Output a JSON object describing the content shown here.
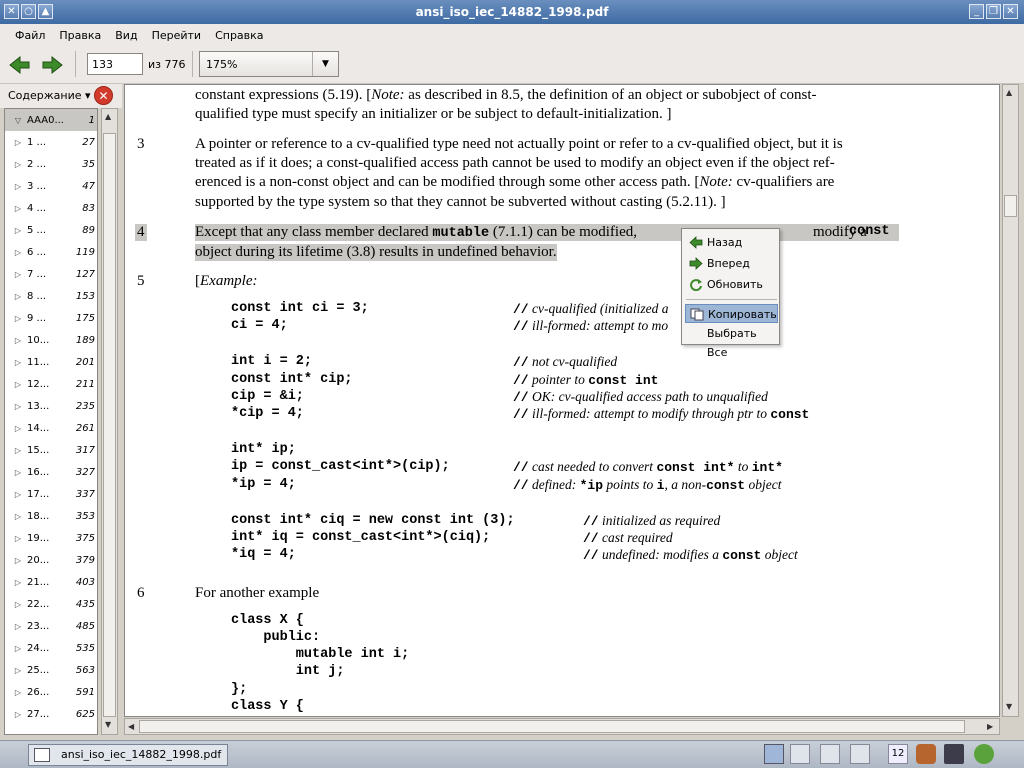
{
  "window": {
    "title": "ansi_iso_iec_14882_1998.pdf"
  },
  "menu": [
    "Файл",
    "Правка",
    "Вид",
    "Перейти",
    "Справка"
  ],
  "toolbar": {
    "page_value": "133",
    "page_of": "из 776",
    "zoom": "175%"
  },
  "sidebar": {
    "header": "Содержание",
    "items": [
      {
        "label": "AAA0...",
        "page": "1",
        "selected": true
      },
      {
        "label": "1 ...",
        "page": "27"
      },
      {
        "label": "2 ...",
        "page": "35"
      },
      {
        "label": "3 ...",
        "page": "47"
      },
      {
        "label": "4 ...",
        "page": "83"
      },
      {
        "label": "5 ...",
        "page": "89"
      },
      {
        "label": "6 ...",
        "page": "119"
      },
      {
        "label": "7 ...",
        "page": "127"
      },
      {
        "label": "8 ...",
        "page": "153"
      },
      {
        "label": "9 ...",
        "page": "175"
      },
      {
        "label": "10...",
        "page": "189"
      },
      {
        "label": "11...",
        "page": "201"
      },
      {
        "label": "12...",
        "page": "211"
      },
      {
        "label": "13...",
        "page": "235"
      },
      {
        "label": "14...",
        "page": "261"
      },
      {
        "label": "15...",
        "page": "317"
      },
      {
        "label": "16...",
        "page": "327"
      },
      {
        "label": "17...",
        "page": "337"
      },
      {
        "label": "18...",
        "page": "353"
      },
      {
        "label": "19...",
        "page": "375"
      },
      {
        "label": "20...",
        "page": "379"
      },
      {
        "label": "21...",
        "page": "403"
      },
      {
        "label": "22...",
        "page": "435"
      },
      {
        "label": "23...",
        "page": "485"
      },
      {
        "label": "24...",
        "page": "535"
      },
      {
        "label": "25...",
        "page": "563"
      },
      {
        "label": "26...",
        "page": "591"
      },
      {
        "label": "27...",
        "page": "625"
      }
    ]
  },
  "doc": {
    "p2_l1a": "constant expressions (5.19).  [",
    "p2_l1b": "Note:",
    "p2_l1c": " as described in 8.5, the definition of an object or subobject of const-",
    "p2_l2": "qualified type must specify an initializer or be subject to default-initialization.  ]",
    "n3": "3",
    "p3_l1": "A pointer or reference to a cv-qualified type need not actually point or refer to a cv-qualified object, but it is",
    "p3_l2": "treated as if it does; a const-qualified access path cannot be used to modify an object even if the object ref-",
    "p3_l3a": "erenced is a non-const object and can be modified through some other access path.  [",
    "p3_l3b": "Note:",
    "p3_l3c": " cv-qualifiers are",
    "p3_l4": "supported by the type system so that they cannot be subverted without casting (5.2.11).  ]",
    "n4": "4",
    "p4_l1a": "Except that any class member declared ",
    "p4_l1b": "mutable",
    "p4_l1c": " (7.1.1) can be modified, ",
    "p4_l1d": "modify a ",
    "p4_l1e": "const",
    "p4_l2": "object during its lifetime (3.8) results in undefined behavior.",
    "n5": "5",
    "p5_l1a": "[",
    "p5_l1b": "Example:",
    "code": [
      "const int ci = 3;",
      "ci = 4;",
      "int i = 2;",
      "const int* cip;",
      "cip = &i;",
      "*cip = 4;",
      "int* ip;",
      "ip = const_cast<int*>(cip);",
      "*ip = 4;",
      "const int* ciq = new const int (3);",
      "int* iq = const_cast<int*>(ciq);",
      "*iq = 4;"
    ],
    "comment_slashes": "//",
    "c0": "cv-qualified (initialized a",
    "c1": "ill-formed: attempt to mo",
    "c2": "not cv-qualified",
    "c3a": "pointer to ",
    "c3b": "const int",
    "c4": "OK: cv-qualified access path to unqualified",
    "c5a": "ill-formed: attempt to modify through ptr to ",
    "c5b": "const",
    "c6a": "cast needed to convert ",
    "c6b": "const int*",
    "c6c": " to ",
    "c6d": "int*",
    "c7a": "defined: ",
    "c7b": "*ip",
    "c7c": " points to ",
    "c7d": "i",
    "c7e": ", a non-",
    "c7f": "const",
    "c7g": " object",
    "c8": "initialized as required",
    "c9": "cast required",
    "c10a": "undefined: modifies a ",
    "c10b": "const",
    "c10c": " object",
    "n6": "6",
    "p6": "For another example",
    "code2": [
      "class X {",
      "    public:",
      "        mutable int i;",
      "        int j;",
      "};",
      "class Y {"
    ]
  },
  "context_menu": {
    "back": "Назад",
    "forward": "Вперед",
    "reload": "Обновить",
    "copy": "Копировать",
    "select_all": "Выбрать Все"
  },
  "taskbar": {
    "item": "ansi_iso_iec_14882_1998.pdf",
    "workspace": "12"
  }
}
